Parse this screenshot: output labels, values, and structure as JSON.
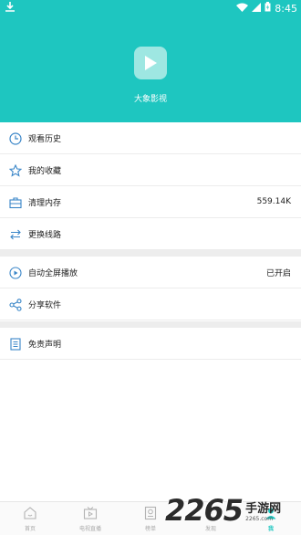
{
  "status_bar": {
    "time": "8:45"
  },
  "header": {
    "app_name": "大象影视"
  },
  "menu": {
    "group1": [
      {
        "label": "观看历史",
        "value": "",
        "icon": "clock-icon"
      },
      {
        "label": "我的收藏",
        "value": "",
        "icon": "star-icon"
      },
      {
        "label": "清理内存",
        "value": "559.14K",
        "icon": "briefcase-icon"
      },
      {
        "label": "更换线路",
        "value": "",
        "icon": "switch-route-icon"
      }
    ],
    "group2": [
      {
        "label": "自动全屏播放",
        "value": "已开启",
        "icon": "play-circle-icon"
      },
      {
        "label": "分享软件",
        "value": "",
        "icon": "share-icon"
      }
    ],
    "group3": [
      {
        "label": "免责声明",
        "value": "",
        "icon": "document-icon"
      }
    ]
  },
  "tabbar": [
    {
      "label": "首页",
      "icon": "home-icon",
      "active": false
    },
    {
      "label": "电视直播",
      "icon": "tv-icon",
      "active": false
    },
    {
      "label": "榜单",
      "icon": "ranking-icon",
      "active": false
    },
    {
      "label": "发现",
      "icon": "discover-icon",
      "active": false
    },
    {
      "label": "我",
      "icon": "profile-icon",
      "active": true
    }
  ],
  "watermark": {
    "number": "2265",
    "site": "手游网",
    "domain": "2265.com"
  },
  "colors": {
    "accent": "#1ec6c0",
    "icon_blue": "#3a86c8"
  }
}
